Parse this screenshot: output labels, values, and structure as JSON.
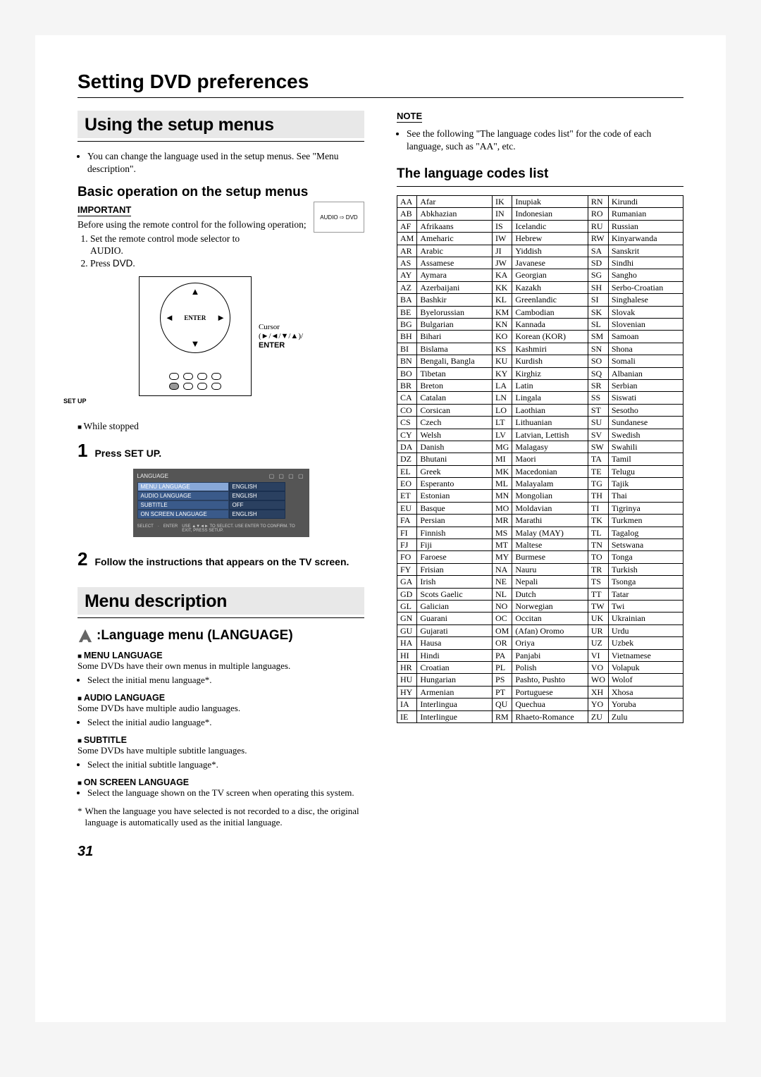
{
  "main_title": "Setting DVD preferences",
  "page_number": "31",
  "left": {
    "section_title": "Using the setup menus",
    "intro_bullet": "You can change the language used in the setup menus. See \"Menu description\".",
    "basic_header": "Basic operation on the setup menus",
    "important_label": "IMPORTANT",
    "important_text": "Before using the remote control for the following operation;",
    "important_steps": {
      "s1a": "Set the remote control mode selector to",
      "s1b": "AUDIO.",
      "s2a": "Press ",
      "s2b": "DVD",
      "s2c": "."
    },
    "audio_dvd_icon": {
      "left": "AUDIO",
      "right": "DVD"
    },
    "remote": {
      "enter": "ENTER",
      "setup_label": "SET UP",
      "cursor_line1": "Cursor",
      "cursor_line2": "(►/◄/▼/▲)/",
      "cursor_line3": "ENTER"
    },
    "while_stopped": "While stopped",
    "steps": {
      "s1_num": "1",
      "s1_text": "Press SET UP.",
      "s2_num": "2",
      "s2_text": "Follow the instructions that appears on the TV screen."
    },
    "osd": {
      "tab": "LANGUAGE",
      "rows": [
        {
          "label": "MENU LANGUAGE",
          "value": "ENGLISH"
        },
        {
          "label": "AUDIO LANGUAGE",
          "value": "ENGLISH"
        },
        {
          "label": "SUBTITLE",
          "value": "OFF"
        },
        {
          "label": "ON SCREEN LANGUAGE",
          "value": "ENGLISH"
        }
      ],
      "footer_select": "SELECT",
      "footer_enter": "ENTER",
      "footer_hint": "USE ▲▼◄► TO SELECT.  USE ENTER TO CONFIRM.  TO EXIT, PRESS SETUP."
    },
    "menu_desc_title": "Menu description",
    "lang_menu_header": ":Language menu (LANGUAGE)",
    "settings": {
      "menu_lang": {
        "name": "MENU LANGUAGE",
        "desc": "Some DVDs have their own menus in multiple languages.",
        "bullet": "Select the initial menu language*."
      },
      "audio_lang": {
        "name": "AUDIO LANGUAGE",
        "desc": "Some DVDs have multiple audio languages.",
        "bullet": "Select the initial audio language*."
      },
      "subtitle": {
        "name": "SUBTITLE",
        "desc": "Some DVDs have multiple subtitle languages.",
        "bullet": "Select the initial subtitle language*."
      },
      "osd_lang": {
        "name": "ON SCREEN LANGUAGE",
        "bullet": "Select the language shown on the TV screen when operating this system."
      }
    },
    "footnote_ast": "*",
    "footnote": "When the language you have selected is not recorded to a disc, the original language is automatically used as the initial language."
  },
  "right": {
    "note_label": "NOTE",
    "note_text": "See the following \"The language codes list\" for the code of each language, such as \"AA\", etc.",
    "list_header": "The language codes list",
    "codes": [
      [
        "AA",
        "Afar",
        "IK",
        "Inupiak",
        "RN",
        "Kirundi"
      ],
      [
        "AB",
        "Abkhazian",
        "IN",
        "Indonesian",
        "RO",
        "Rumanian"
      ],
      [
        "AF",
        "Afrikaans",
        "IS",
        "Icelandic",
        "RU",
        "Russian"
      ],
      [
        "AM",
        "Ameharic",
        "IW",
        "Hebrew",
        "RW",
        "Kinyarwanda"
      ],
      [
        "AR",
        "Arabic",
        "JI",
        "Yiddish",
        "SA",
        "Sanskrit"
      ],
      [
        "AS",
        "Assamese",
        "JW",
        "Javanese",
        "SD",
        "Sindhi"
      ],
      [
        "AY",
        "Aymara",
        "KA",
        "Georgian",
        "SG",
        "Sangho"
      ],
      [
        "AZ",
        "Azerbaijani",
        "KK",
        "Kazakh",
        "SH",
        "Serbo-Croatian"
      ],
      [
        "BA",
        "Bashkir",
        "KL",
        "Greenlandic",
        "SI",
        "Singhalese"
      ],
      [
        "BE",
        "Byelorussian",
        "KM",
        "Cambodian",
        "SK",
        "Slovak"
      ],
      [
        "BG",
        "Bulgarian",
        "KN",
        "Kannada",
        "SL",
        "Slovenian"
      ],
      [
        "BH",
        "Bihari",
        "KO",
        "Korean (KOR)",
        "SM",
        "Samoan"
      ],
      [
        "BI",
        "Bislama",
        "KS",
        "Kashmiri",
        "SN",
        "Shona"
      ],
      [
        "BN",
        "Bengali, Bangla",
        "KU",
        "Kurdish",
        "SO",
        "Somali"
      ],
      [
        "BO",
        "Tibetan",
        "KY",
        "Kirghiz",
        "SQ",
        "Albanian"
      ],
      [
        "BR",
        "Breton",
        "LA",
        "Latin",
        "SR",
        "Serbian"
      ],
      [
        "CA",
        "Catalan",
        "LN",
        "Lingala",
        "SS",
        "Siswati"
      ],
      [
        "CO",
        "Corsican",
        "LO",
        "Laothian",
        "ST",
        "Sesotho"
      ],
      [
        "CS",
        "Czech",
        "LT",
        "Lithuanian",
        "SU",
        "Sundanese"
      ],
      [
        "CY",
        "Welsh",
        "LV",
        "Latvian, Lettish",
        "SV",
        "Swedish"
      ],
      [
        "DA",
        "Danish",
        "MG",
        "Malagasy",
        "SW",
        "Swahili"
      ],
      [
        "DZ",
        "Bhutani",
        "MI",
        "Maori",
        "TA",
        "Tamil"
      ],
      [
        "EL",
        "Greek",
        "MK",
        "Macedonian",
        "TE",
        "Telugu"
      ],
      [
        "EO",
        "Esperanto",
        "ML",
        "Malayalam",
        "TG",
        "Tajik"
      ],
      [
        "ET",
        "Estonian",
        "MN",
        "Mongolian",
        "TH",
        "Thai"
      ],
      [
        "EU",
        "Basque",
        "MO",
        "Moldavian",
        "TI",
        "Tigrinya"
      ],
      [
        "FA",
        "Persian",
        "MR",
        "Marathi",
        "TK",
        "Turkmen"
      ],
      [
        "FI",
        "Finnish",
        "MS",
        "Malay (MAY)",
        "TL",
        "Tagalog"
      ],
      [
        "FJ",
        "Fiji",
        "MT",
        "Maltese",
        "TN",
        "Setswana"
      ],
      [
        "FO",
        "Faroese",
        "MY",
        "Burmese",
        "TO",
        "Tonga"
      ],
      [
        "FY",
        "Frisian",
        "NA",
        "Nauru",
        "TR",
        "Turkish"
      ],
      [
        "GA",
        "Irish",
        "NE",
        "Nepali",
        "TS",
        "Tsonga"
      ],
      [
        "GD",
        "Scots Gaelic",
        "NL",
        "Dutch",
        "TT",
        "Tatar"
      ],
      [
        "GL",
        "Galician",
        "NO",
        "Norwegian",
        "TW",
        "Twi"
      ],
      [
        "GN",
        "Guarani",
        "OC",
        "Occitan",
        "UK",
        "Ukrainian"
      ],
      [
        "GU",
        "Gujarati",
        "OM",
        "(Afan) Oromo",
        "UR",
        "Urdu"
      ],
      [
        "HA",
        "Hausa",
        "OR",
        "Oriya",
        "UZ",
        "Uzbek"
      ],
      [
        "HI",
        "Hindi",
        "PA",
        "Panjabi",
        "VI",
        "Vietnamese"
      ],
      [
        "HR",
        "Croatian",
        "PL",
        "Polish",
        "VO",
        "Volapuk"
      ],
      [
        "HU",
        "Hungarian",
        "PS",
        "Pashto, Pushto",
        "WO",
        "Wolof"
      ],
      [
        "HY",
        "Armenian",
        "PT",
        "Portuguese",
        "XH",
        "Xhosa"
      ],
      [
        "IA",
        "Interlingua",
        "QU",
        "Quechua",
        "YO",
        "Yoruba"
      ],
      [
        "IE",
        "Interlingue",
        "RM",
        "Rhaeto-Romance",
        "ZU",
        "Zulu"
      ]
    ]
  }
}
